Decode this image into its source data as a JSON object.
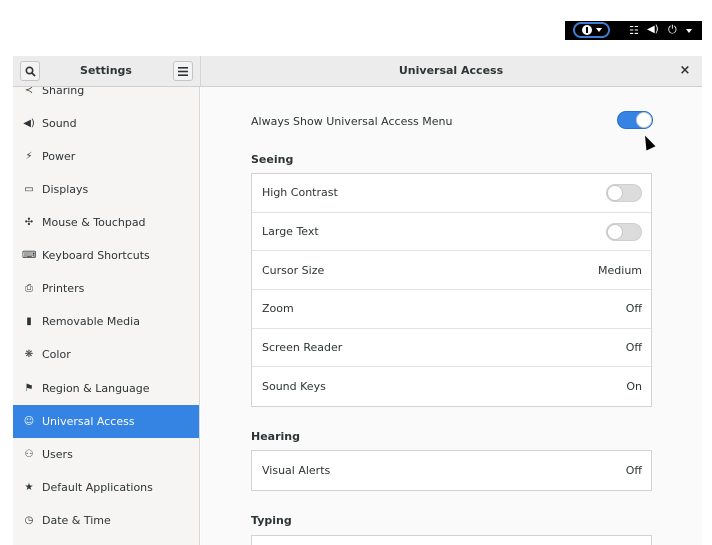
{
  "topbar": {
    "accessibility_icon": "accessibility-icon",
    "network_icon": "network-icon",
    "volume_icon": "volume-icon",
    "power_icon": "power-icon"
  },
  "window": {
    "left_title": "Settings",
    "title": "Universal Access",
    "search_icon": "search-icon",
    "menu_icon": "hamburger-icon",
    "close_label": "×"
  },
  "sidebar": {
    "items": [
      {
        "label": "Sharing",
        "icon": "sharing-icon",
        "glyph": "≺"
      },
      {
        "label": "Sound",
        "icon": "sound-icon",
        "glyph": "◀)"
      },
      {
        "label": "Power",
        "icon": "power-icon",
        "glyph": "⚡"
      },
      {
        "label": "Displays",
        "icon": "display-icon",
        "glyph": "▭"
      },
      {
        "label": "Mouse & Touchpad",
        "icon": "mouse-icon",
        "glyph": "✣"
      },
      {
        "label": "Keyboard Shortcuts",
        "icon": "keyboard-icon",
        "glyph": "⌨"
      },
      {
        "label": "Printers",
        "icon": "printer-icon",
        "glyph": "⎙"
      },
      {
        "label": "Removable Media",
        "icon": "usb-icon",
        "glyph": "▮"
      },
      {
        "label": "Color",
        "icon": "color-icon",
        "glyph": "❋"
      },
      {
        "label": "Region & Language",
        "icon": "flag-icon",
        "glyph": "⚑"
      },
      {
        "label": "Universal Access",
        "icon": "accessibility-icon",
        "glyph": "☺"
      },
      {
        "label": "Users",
        "icon": "users-icon",
        "glyph": "⚇"
      },
      {
        "label": "Default Applications",
        "icon": "star-icon",
        "glyph": "★"
      },
      {
        "label": "Date & Time",
        "icon": "clock-icon",
        "glyph": "◷"
      }
    ],
    "active_index": 10
  },
  "main": {
    "always_show_label": "Always Show Universal Access Menu",
    "always_show_on": true,
    "seeing": {
      "title": "Seeing",
      "rows": [
        {
          "label": "High Contrast",
          "type": "switch",
          "on": false
        },
        {
          "label": "Large Text",
          "type": "switch",
          "on": false
        },
        {
          "label": "Cursor Size",
          "type": "value",
          "value": "Medium"
        },
        {
          "label": "Zoom",
          "type": "value",
          "value": "Off"
        },
        {
          "label": "Screen Reader",
          "type": "value",
          "value": "Off"
        },
        {
          "label": "Sound Keys",
          "type": "value",
          "value": "On"
        }
      ]
    },
    "hearing": {
      "title": "Hearing",
      "rows": [
        {
          "label": "Visual Alerts",
          "type": "value",
          "value": "Off"
        }
      ]
    },
    "typing": {
      "title": "Typing"
    }
  },
  "colors": {
    "accent": "#3584e4",
    "sidebar_bg": "#f6f5f4",
    "panel_bg": "#000000"
  }
}
